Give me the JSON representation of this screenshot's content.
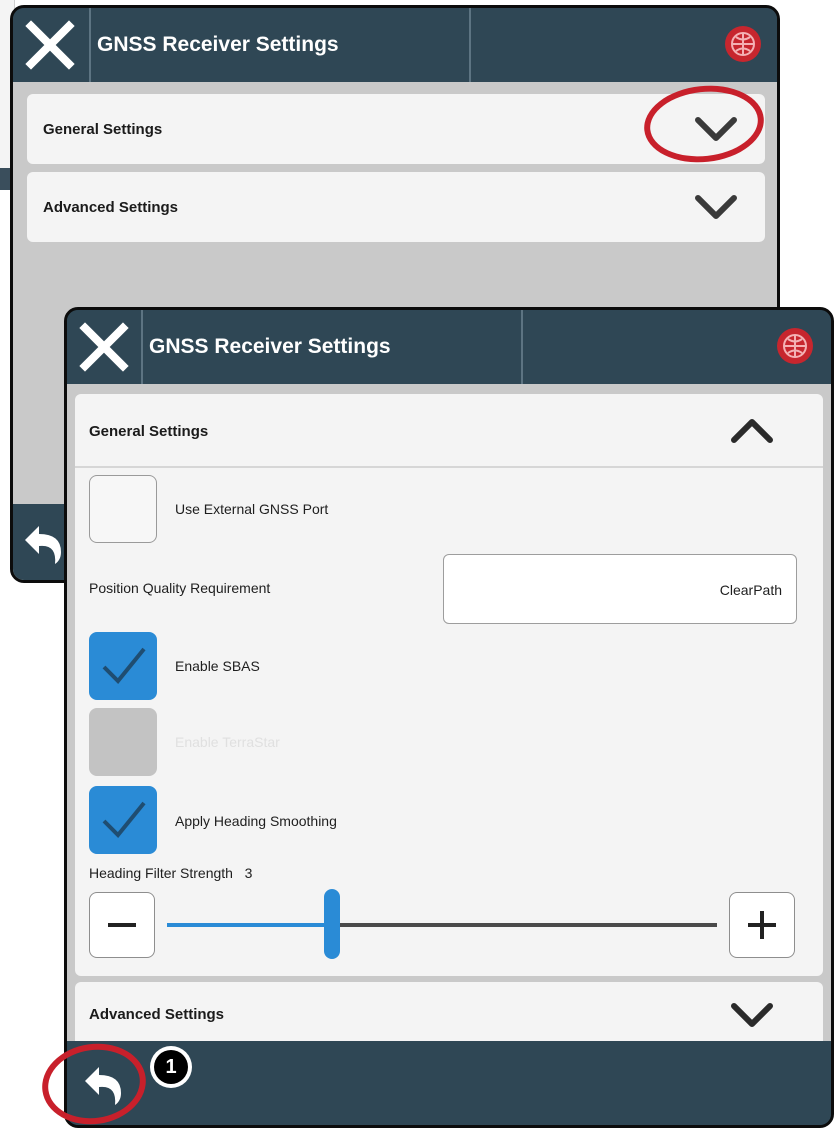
{
  "background_window": {
    "title": "GNSS Receiver Settings",
    "sections": [
      {
        "label": "General Settings",
        "state": "collapsed"
      },
      {
        "label": "Advanced Settings",
        "state": "collapsed"
      }
    ]
  },
  "front_window": {
    "title": "GNSS Receiver Settings",
    "general_section": {
      "label": "General Settings",
      "state": "expanded"
    },
    "options": {
      "use_external_port": {
        "label": "Use External GNSS Port",
        "checked": false
      },
      "position_quality": {
        "label": "Position Quality Requirement",
        "value": "ClearPath"
      },
      "enable_sbas": {
        "label": "Enable SBAS",
        "checked": true
      },
      "enable_terrastar": {
        "label": "Enable TerraStar",
        "checked": false,
        "enabled": false
      },
      "apply_heading_smoothing": {
        "label": "Apply Heading Smoothing",
        "checked": true
      }
    },
    "heading_filter": {
      "label": "Heading Filter Strength",
      "value": "3",
      "level_fraction": 0.3
    },
    "advanced_section": {
      "label": "Advanced Settings",
      "state": "collapsed"
    }
  },
  "callout": {
    "number": "1"
  },
  "colors": {
    "titlebar": "#2f4755",
    "accent": "#2a8bd6",
    "callout": "#c8202b",
    "globe": "#c7262e"
  }
}
